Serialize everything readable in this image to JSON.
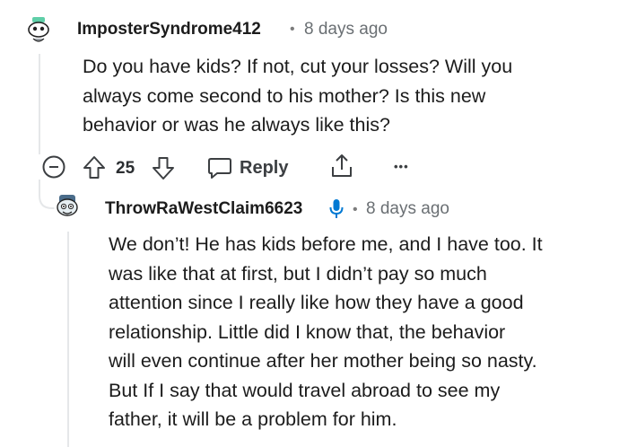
{
  "comment": {
    "username": "ImposterSyndrome412",
    "separator": "•",
    "time": "8 days ago",
    "lines": [
      "Do you have kids? If not, cut your losses? Will you",
      "always come second to his mother? Is this new",
      "behavior or was he always like this?"
    ],
    "actions": {
      "vote_count": "25",
      "reply_label": "Reply",
      "more_label": "•••"
    }
  },
  "reply": {
    "username": "ThrowRaWestClaim6623",
    "separator": "•",
    "time": "8 days ago",
    "lines": [
      "We don’t! He has kids before me, and I have too. It",
      "was like that at first, but I didn’t pay so much",
      "attention since I really like how they have a good",
      "relationship. Little did I know that, the behavior",
      "will even continue after her mother being so nasty.",
      "But If I say that would travel abroad to see my",
      "father, it will be a problem for him."
    ]
  },
  "colors": {
    "accent_blue": "#0079d3",
    "thread_line": "#e5e7e9",
    "meta_gray": "#6a6f73"
  }
}
